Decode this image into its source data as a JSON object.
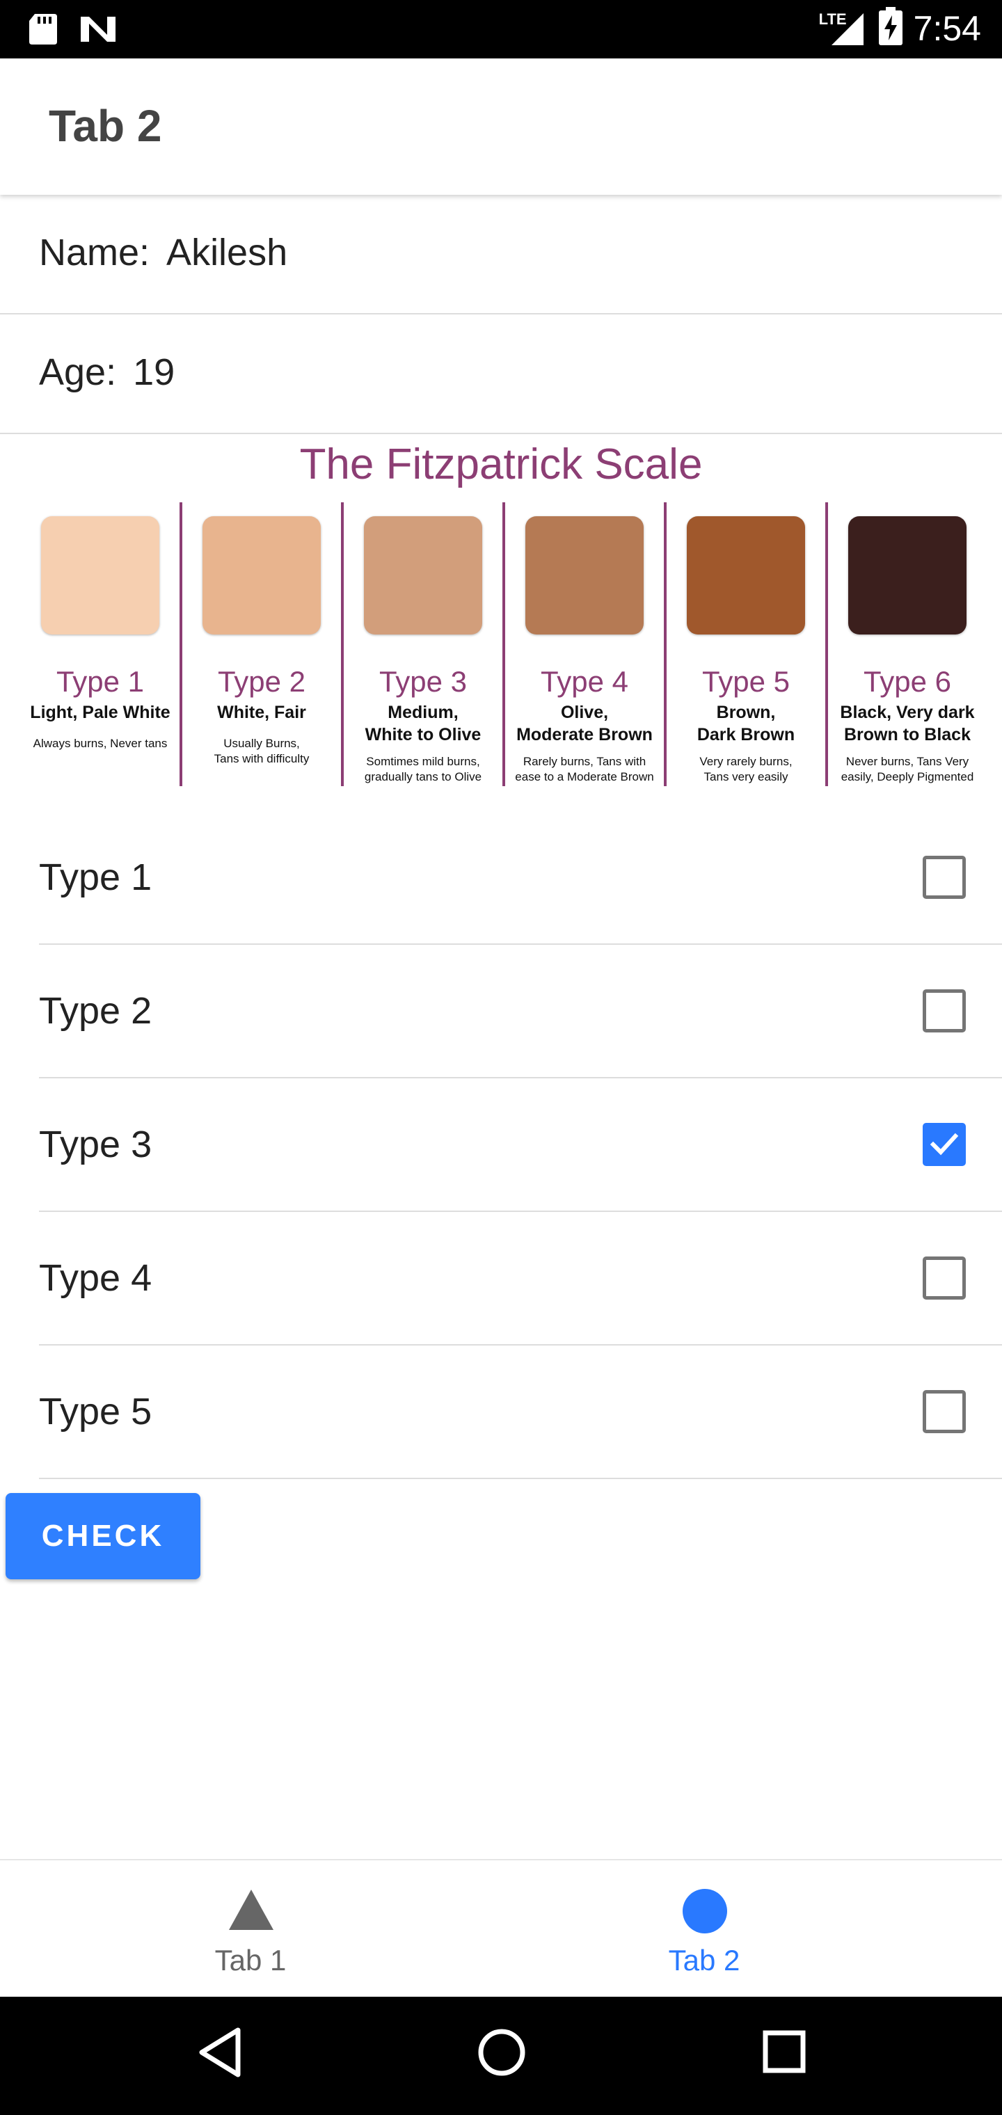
{
  "status_bar": {
    "time": "7:54",
    "network_label": "LTE",
    "icons": [
      "sd-card-icon",
      "n-logo-icon",
      "signal-icon",
      "battery-charging-icon"
    ]
  },
  "header": {
    "title": "Tab 2"
  },
  "profile": {
    "name_label": "Name:",
    "name_value": "Akilesh",
    "age_label": "Age:",
    "age_value": "19"
  },
  "fitzpatrick": {
    "title": "The Fitzpatrick Scale",
    "types": [
      {
        "label": "Type 1",
        "line1": "Light, Pale White",
        "line2": "",
        "note1": "Always burns, Never tans",
        "note2": "",
        "color": "#f6cfb0"
      },
      {
        "label": "Type 2",
        "line1": "White, Fair",
        "line2": "",
        "note1": "Usually Burns,",
        "note2": "Tans with difficulty",
        "color": "#e8b48e"
      },
      {
        "label": "Type 3",
        "line1": "Medium,",
        "line2": "White to Olive",
        "note1": "Somtimes mild burns,",
        "note2": "gradually tans to Olive",
        "color": "#d29e7b"
      },
      {
        "label": "Type 4",
        "line1": "Olive,",
        "line2": "Moderate Brown",
        "note1": "Rarely burns, Tans with",
        "note2": "ease to a Moderate Brown",
        "color": "#b57a54"
      },
      {
        "label": "Type 5",
        "line1": "Brown,",
        "line2": "Dark Brown",
        "note1": "Very rarely burns,",
        "note2": "Tans very easily",
        "color": "#a0582c"
      },
      {
        "label": "Type 6",
        "line1": "Black, Very dark",
        "line2": "Brown to Black",
        "note1": "Never burns, Tans Very",
        "note2": "easily, Deeply Pigmented",
        "color": "#3b1f1d"
      }
    ],
    "accent_color": "#8c3e74"
  },
  "type_options": [
    {
      "label": "Type 1",
      "checked": false
    },
    {
      "label": "Type 2",
      "checked": false
    },
    {
      "label": "Type 3",
      "checked": true
    },
    {
      "label": "Type 4",
      "checked": false
    },
    {
      "label": "Type 5",
      "checked": false
    }
  ],
  "check_button": {
    "label": "CHECK",
    "color": "#2f80ff"
  },
  "tabs": [
    {
      "label": "Tab 1",
      "icon": "triangle-icon",
      "active": false
    },
    {
      "label": "Tab 2",
      "icon": "circle-icon",
      "active": true
    }
  ],
  "colors": {
    "active_tab": "#2979ff",
    "inactive_tab": "#666666"
  }
}
